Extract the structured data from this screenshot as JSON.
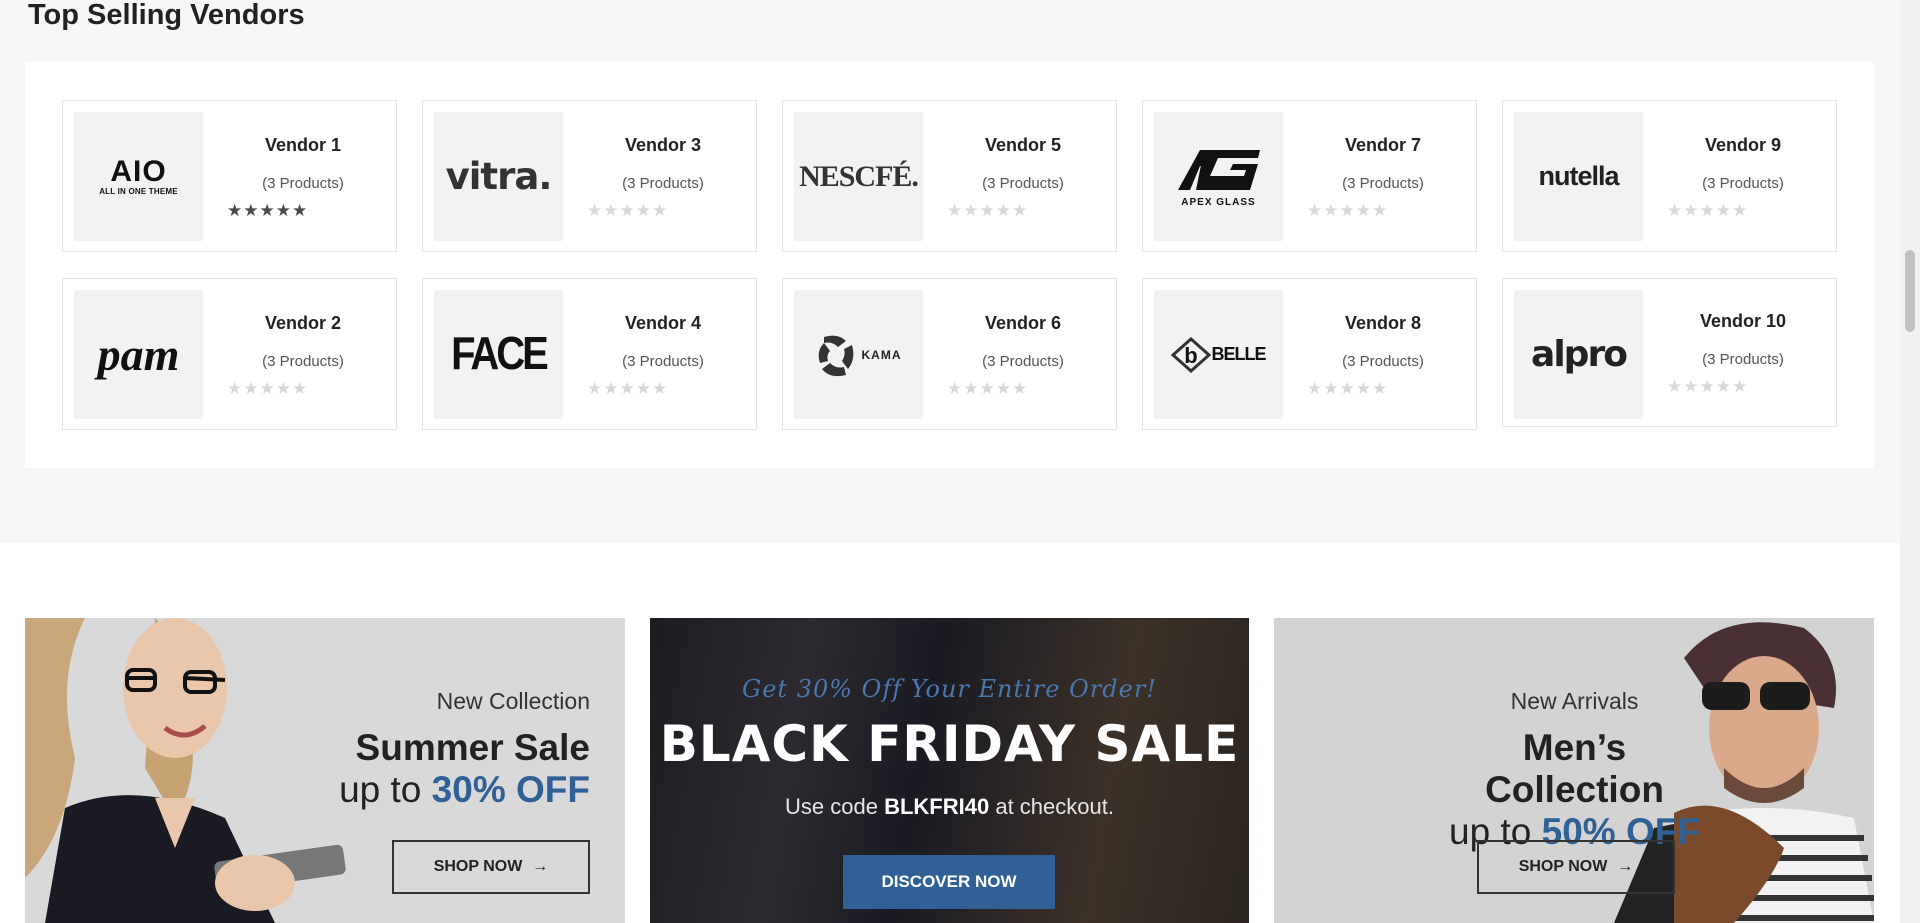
{
  "section": {
    "title": "Top Selling Vendors"
  },
  "vendors": [
    {
      "name": "Vendor 1",
      "count": "(3 Products)",
      "logo": "AIO",
      "logo_sub": "ALL IN ONE THEME",
      "stars": "★★★★★",
      "rated": true
    },
    {
      "name": "Vendor 3",
      "count": "(3 Products)",
      "logo": "vitra.",
      "stars": "★★★★★",
      "rated": false
    },
    {
      "name": "Vendor 5",
      "count": "(3 Products)",
      "logo": "NESCFÉ.",
      "stars": "★★★★★",
      "rated": false
    },
    {
      "name": "Vendor 7",
      "count": "(3 Products)",
      "logo": "APEX GLASS",
      "stars": "★★★★★",
      "rated": false
    },
    {
      "name": "Vendor 9",
      "count": "(3 Products)",
      "logo": "nutella",
      "stars": "★★★★★",
      "rated": false
    },
    {
      "name": "Vendor 2",
      "count": "(3 Products)",
      "logo": "pam",
      "stars": "★★★★★",
      "rated": false
    },
    {
      "name": "Vendor 4",
      "count": "(3 Products)",
      "logo": "FACE",
      "stars": "★★★★★",
      "rated": false
    },
    {
      "name": "Vendor 6",
      "count": "(3 Products)",
      "logo": "KAMA",
      "stars": "★★★★★",
      "rated": false
    },
    {
      "name": "Vendor 8",
      "count": "(3 Products)",
      "logo": "BELLE",
      "stars": "★★★★★",
      "rated": false
    },
    {
      "name": "Vendor 10",
      "count": "(3 Products)",
      "logo": "alpro",
      "stars": "★★★★★",
      "rated": false
    }
  ],
  "banners": {
    "left": {
      "kicker": "New Collection",
      "title": "Summer Sale",
      "sub_prefix": "up to ",
      "sub_accent": "30% OFF",
      "button": "SHOP NOW",
      "button_icon": "→"
    },
    "center": {
      "promo": "Get 30% Off Your Entire Order!",
      "title": "BLACK FRIDAY SALE",
      "code_prefix": "Use code ",
      "code": "BLKFRI40",
      "code_suffix": " at checkout.",
      "button": "DISCOVER NOW"
    },
    "right": {
      "kicker": "New Arrivals",
      "title": "Men’s Collection",
      "sub_prefix": "up to ",
      "sub_accent": "50% OFF",
      "button": "SHOP NOW",
      "button_icon": "→"
    }
  },
  "colors": {
    "accent": "#2f6096",
    "star_filled": "#4a4a4a",
    "star_empty": "#d8d8d8"
  }
}
